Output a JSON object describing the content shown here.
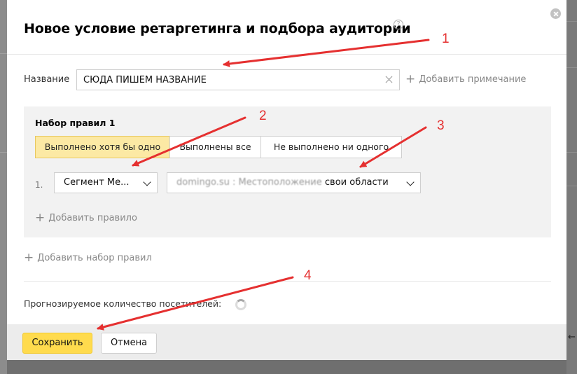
{
  "modal": {
    "title": "Новое условие ретаргетинга и подбора аудитории",
    "help_icon": "question-circle-icon",
    "close_icon": "close-circle-icon"
  },
  "name_field": {
    "label": "Название",
    "value": "СЮДА ПИШЕМ НАЗВАНИЕ"
  },
  "add_note_label": "Добавить примечание",
  "ruleset": {
    "title": "Набор правил  1",
    "modes": [
      {
        "label": "Выполнено хотя бы одно",
        "active": true
      },
      {
        "label": "Выполнены все",
        "active": false
      },
      {
        "label": "Не выполнено ни одного",
        "active": false
      }
    ],
    "rules": [
      {
        "number": "1.",
        "type_select": "Сегмент Ме...",
        "segment_select_blurred": "domingo.su : Местоположение",
        "segment_select_suffix": "свои области"
      }
    ],
    "add_rule_label": "Добавить правило"
  },
  "add_ruleset_label": "Добавить набор правил",
  "forecast_label": "Прогнозируемое количество посетителей:",
  "footer": {
    "save_label": "Сохранить",
    "cancel_label": "Отмена"
  },
  "annotations": {
    "color": "#e53030",
    "labels": [
      "1",
      "2",
      "3",
      "4"
    ]
  },
  "colors": {
    "active_segment": "#fce9a4",
    "save_button": "#ffdb4d",
    "panel": "#f2f2f2"
  }
}
